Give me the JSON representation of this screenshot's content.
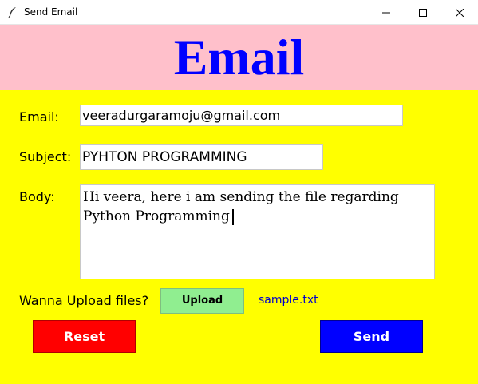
{
  "window": {
    "title": "Send Email",
    "icon": "feather-icon",
    "controls": [
      "minimize-icon",
      "maximize-icon",
      "close-icon"
    ]
  },
  "header": {
    "title": "Email",
    "background": "#ffc0cb",
    "color": "#0000ff"
  },
  "form": {
    "background": "#ffff00",
    "email_label": "Email:",
    "email_value": "veeradurgaramoju@gmail.com",
    "subject_label": "Subject:",
    "subject_value": "PYHTON PROGRAMMING",
    "body_label": "Body:",
    "body_value": "Hi veera, here i am sending the file regarding Python Programming",
    "upload_prompt": "Wanna Upload files?",
    "upload_button": "Upload",
    "attached_file": "sample.txt",
    "reset_button": "Reset",
    "send_button": "Send"
  },
  "colors": {
    "upload_button": "#90ee90",
    "reset_button": "#ff0000",
    "send_button": "#0000ff",
    "file_name": "#0000cd"
  }
}
